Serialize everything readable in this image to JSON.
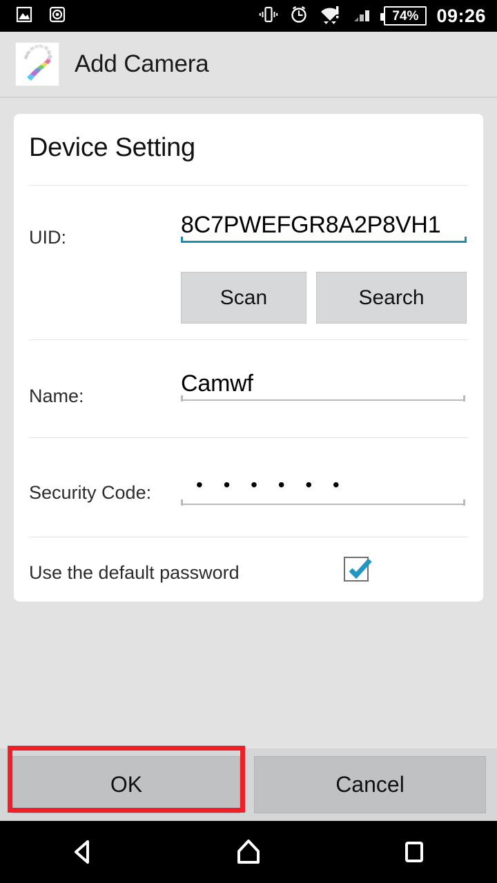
{
  "status_bar": {
    "left_icons": [
      "image-icon",
      "disc-icon"
    ],
    "right_icons": [
      "vibrate-icon",
      "alarm-icon",
      "wifi-alert-icon",
      "signal-icon"
    ],
    "battery_percent": "74%",
    "time": "09:26"
  },
  "title_bar": {
    "icon": "app-logo-icon",
    "title": "Add Camera"
  },
  "card": {
    "heading": "Device Setting",
    "uid": {
      "label": "UID:",
      "value": "8C7PWEFGR8A2P8VH1",
      "focused": true,
      "focus_color": "#1b8fae"
    },
    "uid_buttons": [
      {
        "label": "Scan",
        "name": "scan-button"
      },
      {
        "label": "Search",
        "name": "search-button"
      }
    ],
    "name": {
      "label": "Name:",
      "value": "Camwf"
    },
    "security_code": {
      "label": "Security Code:",
      "masked_value": "• • • • • •",
      "length": 6
    },
    "default_password": {
      "label": "Use the default password",
      "checked": true,
      "check_color": "#2196c4"
    }
  },
  "bottom_bar": {
    "ok_label": "OK",
    "cancel_label": "Cancel",
    "highlight_target": "ok-button",
    "highlight_color": "#ee1f28"
  },
  "nav_bar": {
    "back": "back-icon",
    "home": "home-icon",
    "recents": "recents-icon"
  }
}
